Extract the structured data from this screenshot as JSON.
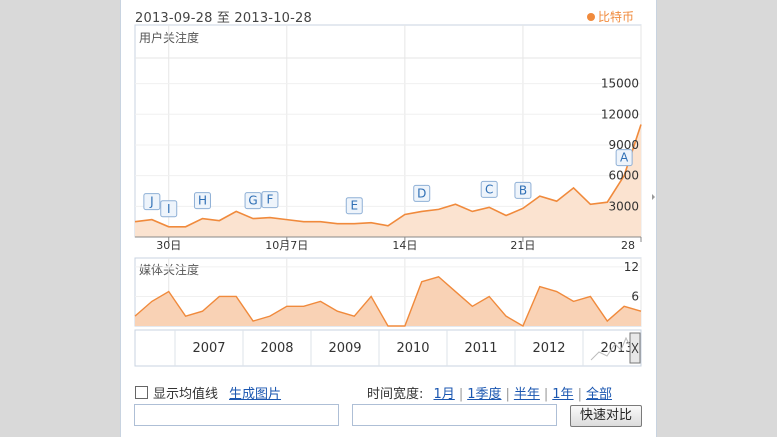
{
  "header": {
    "date_range": "2013-09-28 至 2013-10-28",
    "legend_label": "比特币",
    "legend_color": "#f08a3c"
  },
  "chart_data": [
    {
      "type": "area",
      "title": "用户关注度",
      "ylabel": "",
      "y_ticks": [
        "15000",
        "12000",
        "9000",
        "6000",
        "3000"
      ],
      "y_tick_values": [
        15000,
        12000,
        9000,
        6000,
        3000
      ],
      "ylim": [
        0,
        17500
      ],
      "x_ticks": [
        "30日",
        "10月7日",
        "14日",
        "21日",
        "28"
      ],
      "x_tick_values": [
        2,
        9,
        16,
        23,
        30
      ],
      "x": [
        0,
        1,
        2,
        3,
        4,
        5,
        6,
        7,
        8,
        9,
        10,
        11,
        12,
        13,
        14,
        15,
        16,
        17,
        18,
        19,
        20,
        21,
        22,
        23,
        24,
        25,
        26,
        27,
        28,
        29,
        30
      ],
      "series": [
        {
          "values": [
            1500,
            1700,
            1000,
            1000,
            1800,
            1600,
            2500,
            1800,
            1900,
            1700,
            1500,
            1500,
            1300,
            1300,
            1400,
            1100,
            2200,
            2500,
            2700,
            3200,
            2500,
            2900,
            2100,
            2800,
            4000,
            3500,
            4800,
            3200,
            3400,
            6000,
            11000
          ],
          "color": "#f08a3c"
        }
      ],
      "annotations": [
        {
          "label": "J",
          "x": 1
        },
        {
          "label": "I",
          "x": 2
        },
        {
          "label": "H",
          "x": 4
        },
        {
          "label": "G",
          "x": 7
        },
        {
          "label": "F",
          "x": 8
        },
        {
          "label": "E",
          "x": 13
        },
        {
          "label": "D",
          "x": 17
        },
        {
          "label": "C",
          "x": 21
        },
        {
          "label": "B",
          "x": 23
        },
        {
          "label": "A",
          "x": 29
        }
      ],
      "grid": true
    },
    {
      "type": "area",
      "title": "媒体关注度",
      "y_ticks": [
        "12",
        "6"
      ],
      "y_tick_values": [
        12,
        6
      ],
      "ylim": [
        0,
        13
      ],
      "x": [
        0,
        1,
        2,
        3,
        4,
        5,
        6,
        7,
        8,
        9,
        10,
        11,
        12,
        13,
        14,
        15,
        16,
        17,
        18,
        19,
        20,
        21,
        22,
        23,
        24,
        25,
        26,
        27,
        28,
        29,
        30
      ],
      "series": [
        {
          "values": [
            2,
            5,
            7,
            2,
            3,
            6,
            6,
            1,
            2,
            4,
            4,
            5,
            3,
            2,
            6,
            0,
            0,
            9,
            10,
            7,
            4,
            6,
            2,
            0,
            8,
            7,
            5,
            6,
            1,
            4,
            3
          ],
          "color": "#f08a3c"
        }
      ],
      "grid": true
    }
  ],
  "timeline": {
    "years": [
      "2007",
      "2008",
      "2009",
      "2010",
      "2011",
      "2012",
      "2013"
    ]
  },
  "controls": {
    "avg_line_label": "显示均值线",
    "gen_image_label": "生成图片",
    "time_width_label": "时间宽度:",
    "ranges": [
      "1月",
      "1季度",
      "半年",
      "1年",
      "全部"
    ],
    "quick_compare_label": "快速对比"
  }
}
